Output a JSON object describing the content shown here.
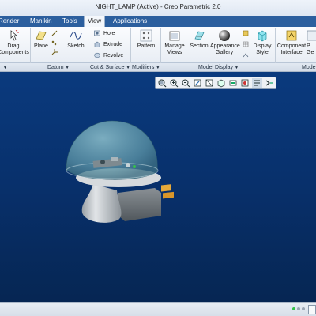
{
  "window": {
    "title": "NIGHT_LAMP (Active) - Creo Parametric 2.0"
  },
  "menu_tabs": [
    {
      "label": "Render",
      "active": false
    },
    {
      "label": "Manikin",
      "active": false
    },
    {
      "label": "Tools",
      "active": false
    },
    {
      "label": "View",
      "active": true
    },
    {
      "label": "Applications",
      "active": false
    }
  ],
  "ribbon": {
    "drag_components": "Drag Components",
    "plane": "Plane",
    "sketch": "Sketch",
    "hole": "Hole",
    "extrude": "Extrude",
    "revolve": "Revolve",
    "pattern": "Pattern",
    "manage_views": "Manage Views",
    "section": "Section",
    "appearance_gallery": "Appearance Gallery",
    "display_style": "Display Style",
    "component_interface": "Component Interface",
    "partial_1": "P",
    "partial_2": "Ge"
  },
  "groups": {
    "datum": "Datum",
    "cut_surface": "Cut & Surface",
    "modifiers": "Modifiers",
    "model_display": "Model Display",
    "model_partial": "Mode"
  },
  "colors": {
    "menubar": "#2c5f9e",
    "viewport_top": "#0a3a7e",
    "viewport_bottom": "#062653",
    "dome": "#6fa7b6",
    "base": "#c8cdd2",
    "plug": "#6d7479",
    "prongs": "#e6a93a",
    "status_green": "#35c24a"
  },
  "view_toolbar_icons": [
    "refit-icon",
    "zoom-in-icon",
    "zoom-out-icon",
    "repaint-icon",
    "saved-orientations-icon",
    "display-style-icon",
    "datum-display-icon",
    "spin-center-icon",
    "annotation-display-icon",
    "more-icon"
  ]
}
